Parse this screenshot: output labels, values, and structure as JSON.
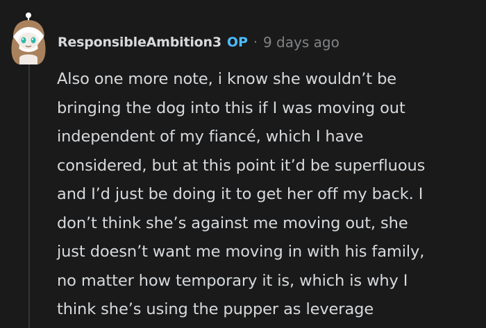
{
  "comment": {
    "author": "ResponsibleAmbition3",
    "op_badge": "OP",
    "separator": "·",
    "timestamp": "9 days ago",
    "body": "Also one more note, i know she wouldn’t be\nbringing the dog into this if I was moving out\nindependent of my fiancé, which I have\nconsidered, but at this point it’d be superfluous\nand I’d just be doing it to get her off my back. I\ndon’t think she’s against me moving out, she\njust doesn’t want me moving in with his family,\nno matter how temporary it is, which is why I\nthink she’s using the pupper as leverage"
  },
  "colors": {
    "background": "#1a1a1b",
    "text": "#d7dadc",
    "muted": "#818384",
    "op_accent": "#4fbcff",
    "thread_line": "#343536"
  },
  "icons": {
    "avatar": "snoo-avatar-icon"
  }
}
